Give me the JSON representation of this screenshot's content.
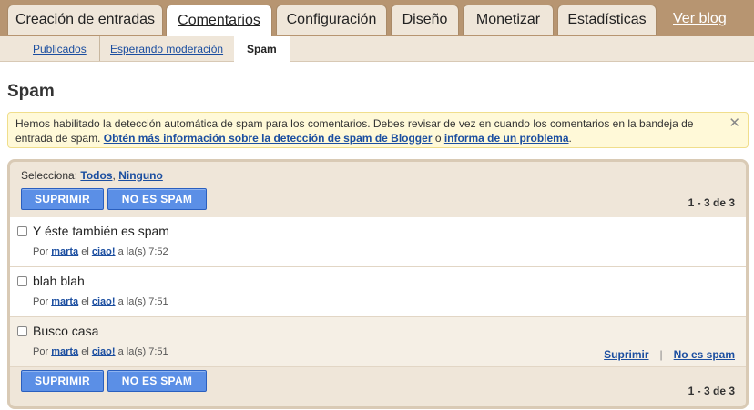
{
  "top_tabs": [
    {
      "label": "Creación de entradas"
    },
    {
      "label": "Comentarios"
    },
    {
      "label": "Configuración"
    },
    {
      "label": "Diseño"
    },
    {
      "label": "Monetizar"
    },
    {
      "label": "Estadísticas"
    }
  ],
  "view_blog_label": "Ver blog",
  "sub_tabs": [
    {
      "label": "Publicados"
    },
    {
      "label": "Esperando moderación"
    },
    {
      "label": "Spam"
    }
  ],
  "page_title": "Spam",
  "notice": {
    "text1": "Hemos habilitado la detección automática de spam para los comentarios. Debes revisar de vez en cuando los comentarios en la bandeja de entrada de spam. ",
    "link1": "Obtén más información sobre la detección de spam de Blogger",
    "text2": " o ",
    "link2": "informa de un problema",
    "text3": ".",
    "close": "✕"
  },
  "select": {
    "label": "Selecciona:",
    "all": "Todos",
    "comma": ",",
    "none": "Ninguno"
  },
  "buttons": {
    "delete": "SUPRIMIR",
    "not_spam": "NO ES SPAM"
  },
  "count_text": "1 - 3 de 3",
  "comments": [
    {
      "title": "Y éste también es spam",
      "by": "Por",
      "author": "marta",
      "on": "el",
      "post": "ciao!",
      "at": "a la(s) 7:52"
    },
    {
      "title": "blah blah",
      "by": "Por",
      "author": "marta",
      "on": "el",
      "post": "ciao!",
      "at": "a la(s) 7:51"
    },
    {
      "title": "Busco casa",
      "by": "Por",
      "author": "marta",
      "on": "el",
      "post": "ciao!",
      "at": "a la(s) 7:51"
    }
  ],
  "row_actions": {
    "delete": "Suprimir",
    "separator": "|",
    "not_spam": "No es spam"
  },
  "colors": {
    "tab_bar": "#b79571",
    "button": "#5b8fe6",
    "link": "#1b4ea0"
  }
}
